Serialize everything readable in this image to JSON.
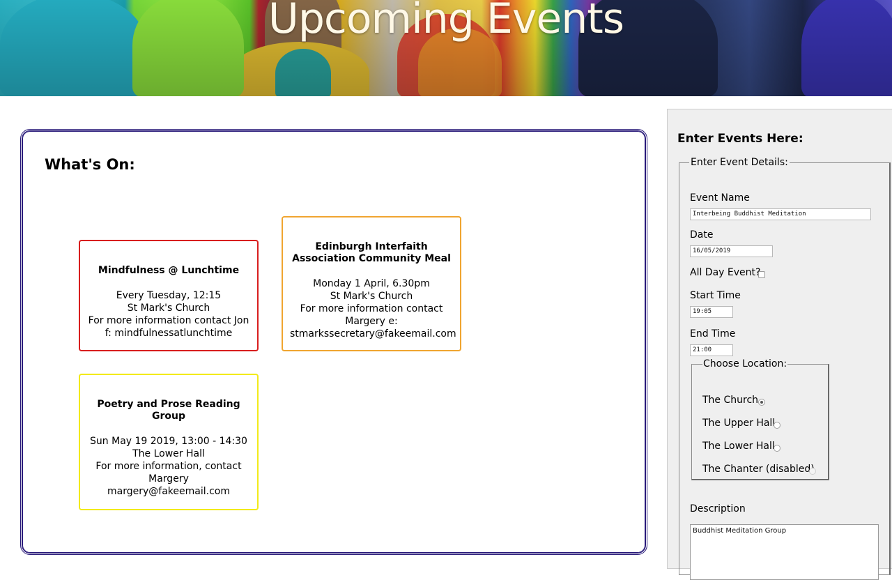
{
  "banner": {
    "title": "Upcoming Events"
  },
  "events_panel": {
    "heading": "What's On:",
    "events": [
      {
        "title": "Mindfulness @ Lunchtime",
        "lines": [
          "Every Tuesday, 12:15",
          "St Mark's Church",
          "For more information contact Jon",
          "f: mindfulnessatlunchtime"
        ],
        "border_color": "#d81e1e"
      },
      {
        "title": "Edinburgh Interfaith Association Community Meal",
        "lines": [
          "Monday 1 April, 6.30pm",
          "St Mark's Church",
          "For more information contact",
          "Margery e:",
          "stmarkssecretary@fakeemail.com"
        ],
        "border_color": "#f0a530"
      },
      {
        "title": "Poetry and Prose Reading Group",
        "lines": [
          "Sun May 19 2019, 13:00 - 14:30",
          "The Lower Hall",
          "For more information, contact",
          "Margery",
          "margery@fakeemail.com"
        ],
        "border_color": "#f2ea1a"
      }
    ]
  },
  "form": {
    "heading": "Enter Events Here:",
    "legend": "Enter Event Details:",
    "event_name": {
      "label": "Event Name",
      "value": "Interbeing Buddhist Meditation"
    },
    "date": {
      "label": "Date",
      "value": "16/05/2019"
    },
    "all_day": {
      "label": "All Day Event?",
      "checked": false
    },
    "start_time": {
      "label": "Start Time",
      "value": "19:05"
    },
    "end_time": {
      "label": "End Time",
      "value": "21:00"
    },
    "location": {
      "legend": "Choose Location:",
      "options": [
        {
          "label": "The Church",
          "selected": true,
          "disabled": false
        },
        {
          "label": "The Upper Hall",
          "selected": false,
          "disabled": false
        },
        {
          "label": "The Lower Hall",
          "selected": false,
          "disabled": false
        },
        {
          "label": "The Chanter (disabled)",
          "selected": false,
          "disabled": true
        }
      ]
    },
    "description": {
      "label": "Description",
      "value": "Buddhist Meditation Group"
    }
  },
  "colors": {
    "panel_border": "#2a1b7a",
    "sidebar_bg": "#efefef"
  }
}
